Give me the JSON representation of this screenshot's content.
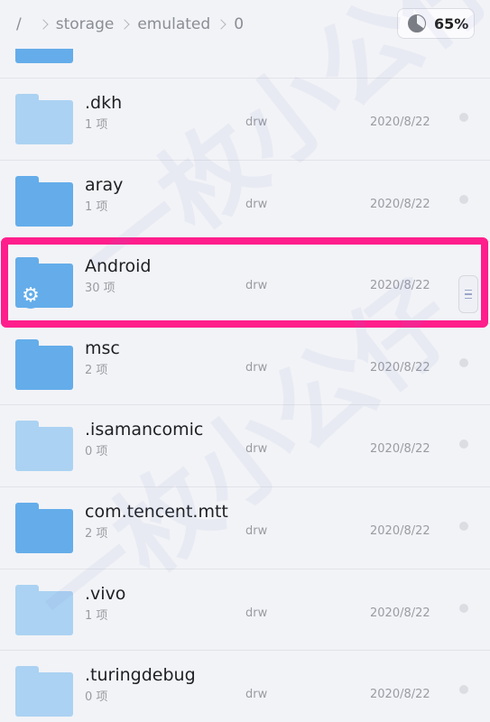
{
  "header": {
    "breadcrumbs": [
      "/",
      "storage",
      "emulated",
      "0"
    ],
    "storage_percent": "65%"
  },
  "files": [
    {
      "name": ".dkh",
      "count": "1 项",
      "perm": "drw",
      "date": "2020/8/22",
      "shade": "light",
      "settings": false
    },
    {
      "name": "aray",
      "count": "1 项",
      "perm": "drw",
      "date": "2020/8/22",
      "shade": "dark",
      "settings": false
    },
    {
      "name": "Android",
      "count": "30 项",
      "perm": "drw",
      "date": "2020/8/22",
      "shade": "dark",
      "settings": true
    },
    {
      "name": "msc",
      "count": "2 项",
      "perm": "drw",
      "date": "2020/8/22",
      "shade": "dark",
      "settings": false
    },
    {
      "name": ".isamancomic",
      "count": "0 项",
      "perm": "drw",
      "date": "2020/8/22",
      "shade": "light",
      "settings": false
    },
    {
      "name": "com.tencent.mtt",
      "count": "2 项",
      "perm": "drw",
      "date": "2020/8/22",
      "shade": "dark",
      "settings": false
    },
    {
      "name": ".vivo",
      "count": "1 项",
      "perm": "drw",
      "date": "2020/8/22",
      "shade": "light",
      "settings": false
    },
    {
      "name": ".turingdebug",
      "count": "0 项",
      "perm": "drw",
      "date": "2020/8/22",
      "shade": "light",
      "settings": false
    }
  ],
  "highlighted_file": "Android",
  "watermark": "一枚小公仔",
  "colors": {
    "highlight": "#ff1e8c",
    "folder_dark": "#64adea",
    "folder_light": "#abd2f2",
    "background": "#f2f3f7"
  }
}
